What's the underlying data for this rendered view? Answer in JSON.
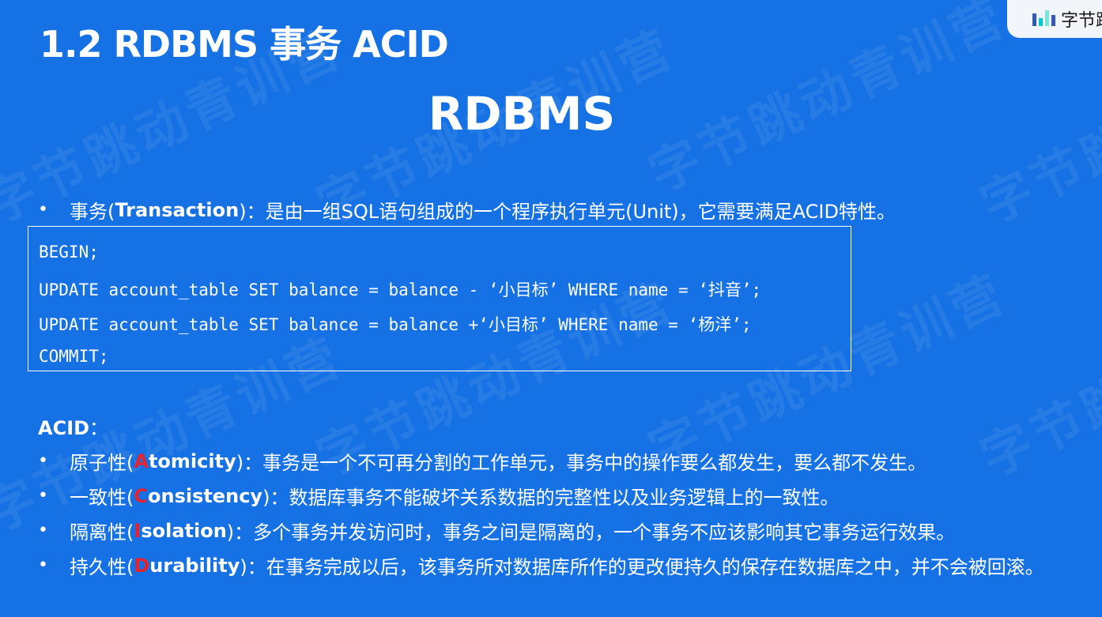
{
  "logo": {
    "text": "字节跳动"
  },
  "slide": {
    "title": "1.2  RDBMS 事务 ACID",
    "subtitle": "RDBMS",
    "watermark": "字节跳动青训营"
  },
  "transaction": {
    "prefix": "事务(",
    "term": "Transaction",
    "suffix": ")：是由一组SQL语句组成的一个程序执行单元(Unit)，它需要满足ACID特性。"
  },
  "code_lines": [
    "BEGIN;",
    "UPDATE account_table SET balance = balance - ‘小目标’ WHERE name = ‘抖音’;",
    "UPDATE account_table SET balance = balance +‘小目标’ WHERE name = ‘杨洋’;",
    "COMMIT;"
  ],
  "acid": {
    "heading": "ACID",
    "heading_suffix": "：",
    "items": [
      {
        "prefix": "原子性(",
        "initial": "A",
        "rest": "tomicity",
        "desc": ")：事务是一个不可再分割的工作单元，事务中的操作要么都发生，要么都不发生。"
      },
      {
        "prefix": "一致性(",
        "initial": "C",
        "rest": "onsistency",
        "desc": ")：数据库事务不能破坏关系数据的完整性以及业务逻辑上的一致性。"
      },
      {
        "prefix": "隔离性(",
        "initial": "I",
        "rest": "solation",
        "desc": ")：多个事务并发访问时，事务之间是隔离的，一个事务不应该影响其它事务运行效果。"
      },
      {
        "prefix": "持久性(",
        "initial": "D",
        "rest": "urability",
        "desc": ")：在事务完成以后，该事务所对数据库所作的更改便持久的保存在数据库之中，并不会被回滚。"
      }
    ]
  },
  "colors": {
    "background": "#1672e4",
    "accent_red": "#e8222a",
    "text": "#ffffff"
  },
  "bullet_symbol": "•"
}
